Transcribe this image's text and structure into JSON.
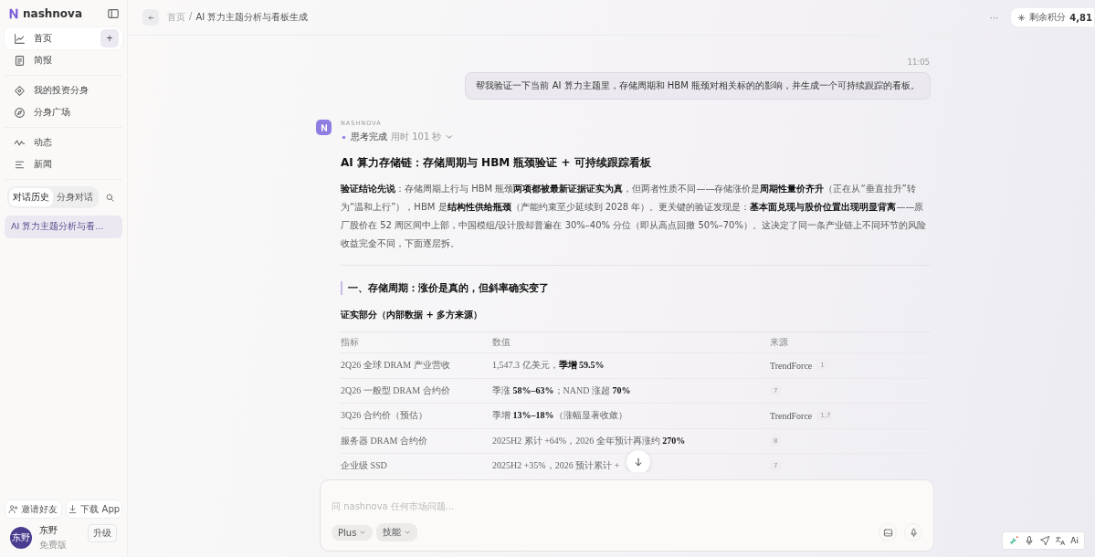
{
  "sidebar": {
    "logo": "nashnova",
    "nav_groups": [
      [
        {
          "label": "首页",
          "selected": true,
          "new_button": "+"
        },
        {
          "label": "简报",
          "selected": false
        }
      ],
      [
        {
          "label": "我的投资分身",
          "selected": false
        },
        {
          "label": "分身广场",
          "selected": false
        }
      ],
      [
        {
          "label": "动态",
          "selected": false
        },
        {
          "label": "新闻",
          "selected": false
        }
      ]
    ],
    "history_tabs": [
      {
        "label": "对话历史",
        "selected": true
      },
      {
        "label": "分身对话",
        "selected": false
      }
    ],
    "conversations": [
      {
        "title": "AI 算力主题分析与看...",
        "selected": true
      }
    ],
    "footer_buttons": [
      {
        "label": "邀请好友"
      },
      {
        "label": "下载 App"
      }
    ],
    "user": {
      "avatar_text": "东野",
      "name": "东野",
      "plan": "免费版",
      "upgrade": "升级"
    }
  },
  "header": {
    "breadcrumb": [
      "首页",
      "AI 算力主题分析与看板生成"
    ],
    "breadcrumb_separator": "/",
    "more": "···",
    "credits_label": "剩余积分",
    "credits_value": "4,81"
  },
  "chat": {
    "user_message": {
      "time": "11:05",
      "text": "帮我验证一下当前 AI 算力主题里，存储周期和 HBM 瓶颈对相关标的的影响，并生成一个可持续跟踪的看板。"
    },
    "assistant": {
      "name": "NASHNOVA",
      "thinking": {
        "status": "思考完成",
        "duration": "用时 101 秒",
        "expanded": false
      },
      "title": "AI 算力存储链：存储周期与 HBM 瓶颈验证 + 可持续跟踪看板",
      "summary": "**验证结论先说**：存储周期上行与 HBM 瓶颈**两项都被最新证据证实为真**，但两者性质不同——存储涨价是**周期性量价齐升**（正在从“垂直拉升”转为“温和上行”），HBM 是**结构性供给瓶颈**（产能约束至少延续到 2028 年）。更关键的验证发现是：**基本面兑现与股价位置出现明显背离**——原厂股价在 52 周区间中上部，中国模组/设计股却普遍在 30%–40% 分位（即从高点回撤 50%–70%）。这决定了同一条产业链上不同环节的风险收益完全不同，下面逐层拆。",
      "section_heading": "一、存储周期：涨价是真的，但斜率确实变了",
      "subheading": "证实部分（内部数据 + 多方来源）",
      "table": {
        "columns": [
          "指标",
          "数值",
          "来源"
        ],
        "rows": [
          {
            "metric": "2Q26 全球 DRAM 产业营收",
            "value": "1,547.3 亿美元，**季增 59.5%**",
            "source": "TrendForce",
            "refs": "1"
          },
          {
            "metric": "2Q26 一般型 DRAM 合约价",
            "value": "季涨 **58%–63%**；NAND 涨超 **70%**",
            "source": "",
            "refs": "7"
          },
          {
            "metric": "3Q26 合约价（预估）",
            "value": "季增 **13%–18%**（涨幅显著收敛）",
            "source": "TrendForce",
            "refs": "1,7"
          },
          {
            "metric": "服务器 DRAM 合约价",
            "value": "2025H2 累计 +64%，2026 全年预计再涨约 **270%**",
            "source": "",
            "refs": "8"
          },
          {
            "metric": "企业级 SSD",
            "value": "2025H2 +35%，2026 预计累计 +",
            "source": "",
            "refs": "7"
          }
        ]
      }
    }
  },
  "composer": {
    "placeholder": "问 nashnova 任何市场问题...",
    "chips": [
      "Plus",
      "技能"
    ]
  },
  "floating_toolbar": {
    "ai_label": "Ai"
  }
}
